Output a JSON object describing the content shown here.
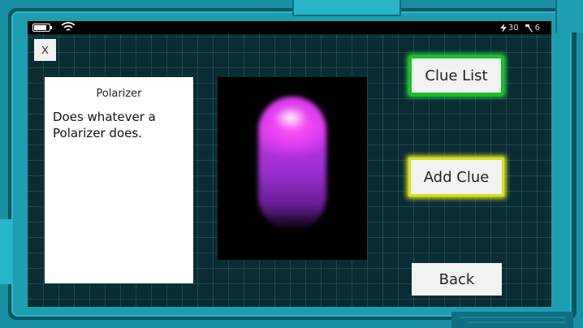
{
  "status_bar": {
    "battery_level": 0.85,
    "energy_value": "30",
    "tools_value": "6"
  },
  "close_button": {
    "label": "X"
  },
  "clue_card": {
    "title": "Polarizer",
    "description": "Does whatever a Polarizer does."
  },
  "item_view": {
    "item_icon": "capsule-icon",
    "item_color": "#e23ef0"
  },
  "buttons": {
    "clue_list": "Clue List",
    "add_clue": "Add Clue",
    "back": "Back"
  },
  "colors": {
    "frame": "#1d9db0",
    "screen_bg": "#0b2c33",
    "clue_list_border": "#16c21a",
    "add_clue_border": "#d8e21a"
  }
}
